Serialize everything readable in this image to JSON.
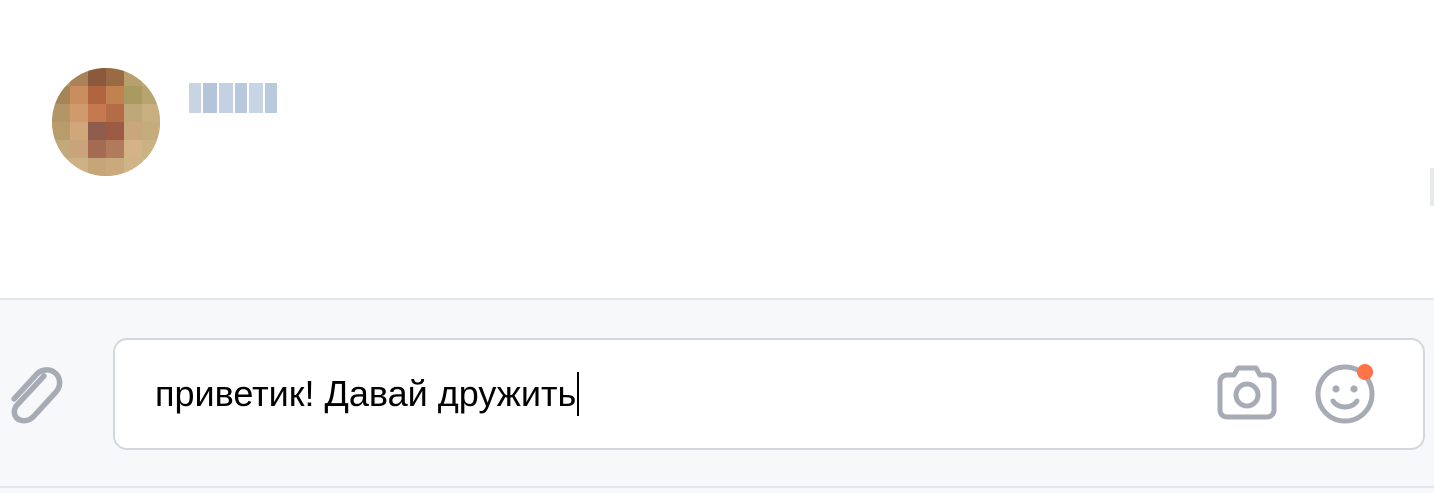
{
  "composer": {
    "message_value": "приветик! Давай дружить",
    "icons": {
      "attach": "paperclip-icon",
      "camera": "camera-icon",
      "emoji": "smiley-icon"
    },
    "emoji_badge_color": "#ff7348"
  },
  "colors": {
    "icon_gray": "#a7abb5",
    "composer_bg": "#f7f8fa",
    "input_border": "#d3d6dc",
    "text": "#000000"
  }
}
